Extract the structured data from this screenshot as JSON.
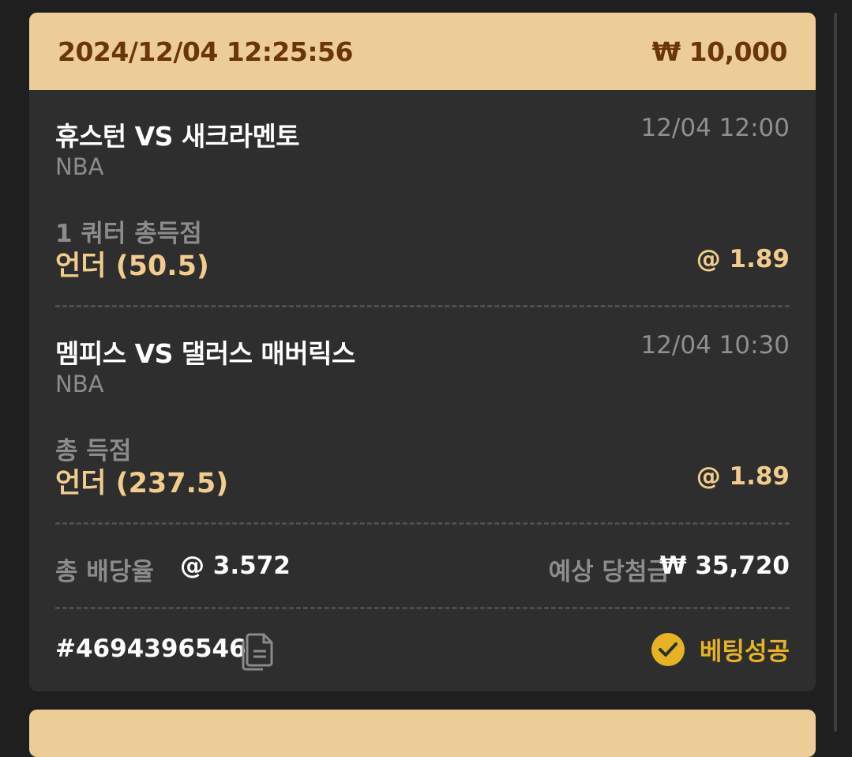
{
  "header": {
    "datetime": "2024/12/04 12:25:56",
    "stake": "₩ 10,000"
  },
  "bets": [
    {
      "match": "휴스턴 VS 새크라멘토",
      "date": "12/04 12:00",
      "league": "NBA",
      "market": "1 쿼터 총득점",
      "pick": "언더 (50.5)",
      "odds": "@ 1.89"
    },
    {
      "match": "멤피스 VS 댈러스 매버릭스",
      "date": "12/04 10:30",
      "league": "NBA",
      "market": "총 득점",
      "pick": "언더 (237.5)",
      "odds": "@ 1.89"
    }
  ],
  "summary": {
    "total_odds_label": "총 배당율",
    "total_odds": "@ 3.572",
    "expected_label": "예상 당첨금",
    "expected_win": "₩ 35,720"
  },
  "footer": {
    "ticket_id": "#4694396546",
    "copy_icon": "copy-icon",
    "status_icon": "check-circle-icon",
    "status": "베팅성공"
  },
  "colors": {
    "header_bg": "#edcd97",
    "header_text": "#6a3608",
    "pick_text": "#f1cc8d",
    "status": "#e6b422",
    "card_bg": "#2e2e2e"
  }
}
